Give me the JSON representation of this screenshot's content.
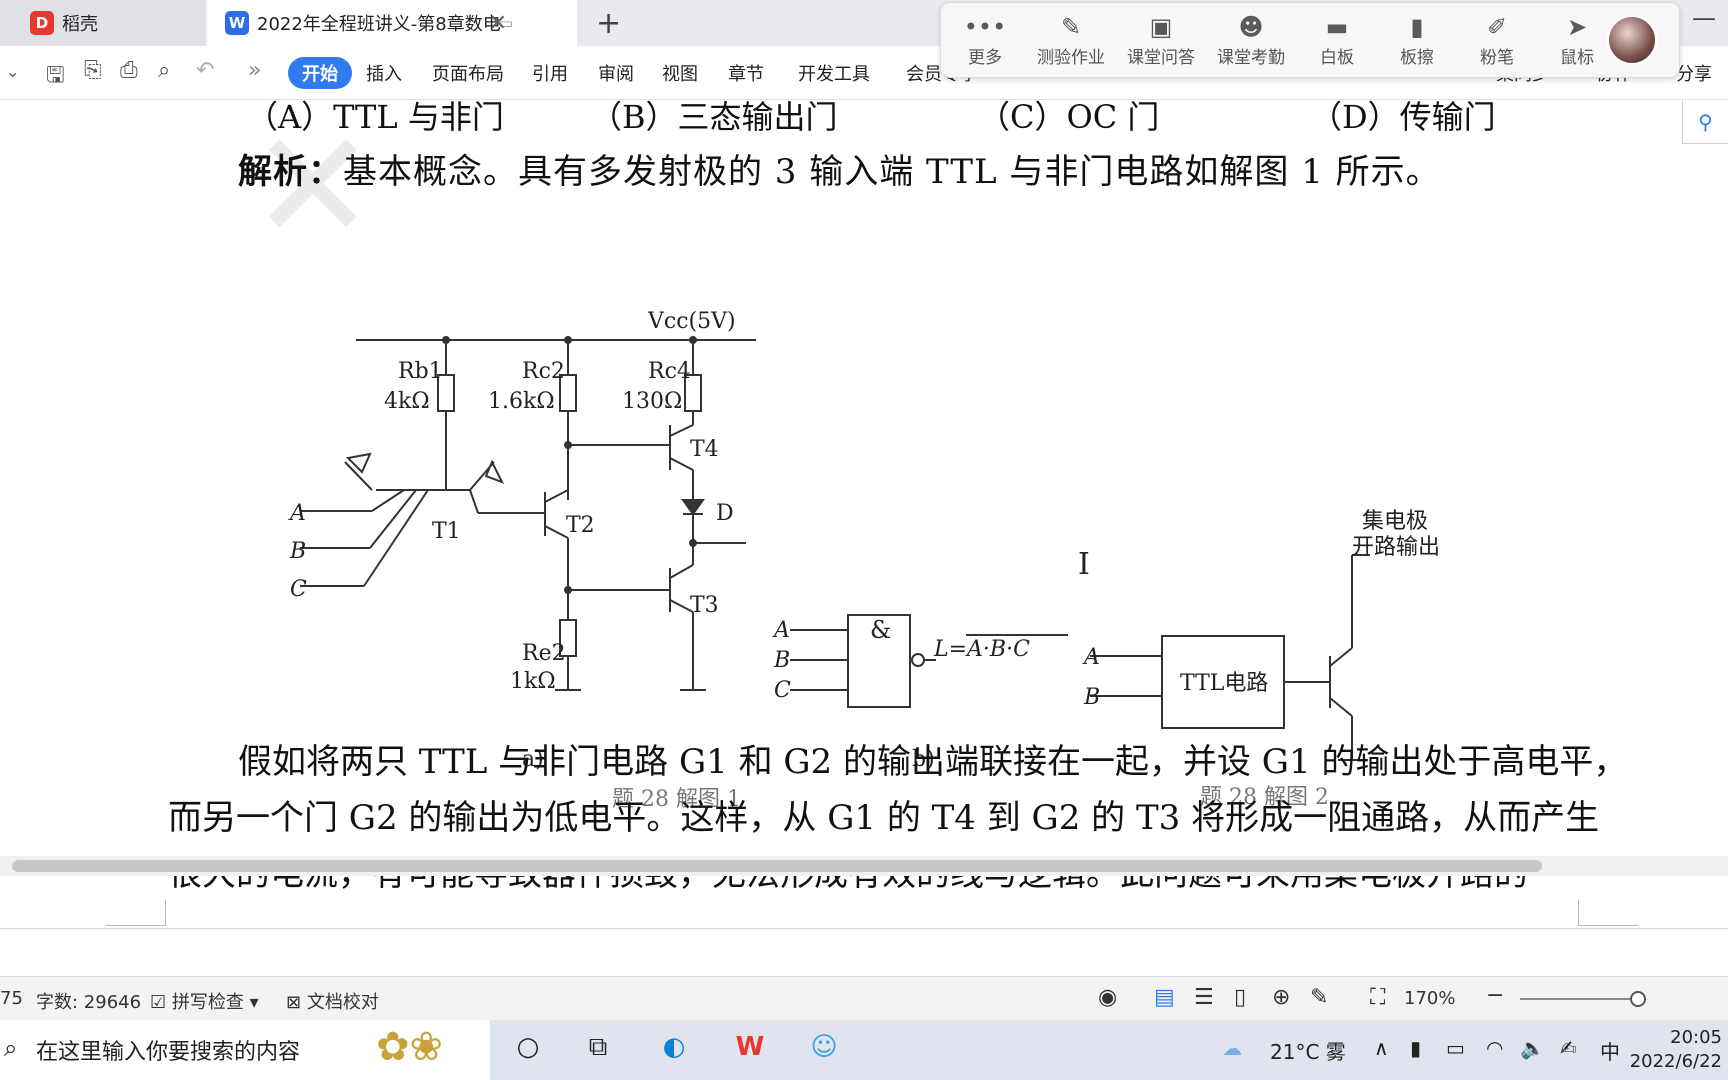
{
  "tabs": [
    {
      "label": "稻壳"
    },
    {
      "label": "2022年全程班讲义-第8章数电"
    }
  ],
  "class_toolbar": [
    {
      "label": "更多"
    },
    {
      "label": "测验作业"
    },
    {
      "label": "课堂问答"
    },
    {
      "label": "课堂考勤"
    },
    {
      "label": "白板"
    },
    {
      "label": "板擦"
    },
    {
      "label": "粉笔"
    },
    {
      "label": "鼠标"
    }
  ],
  "ribbon": {
    "start": "开始",
    "menus": [
      "插入",
      "页面布局",
      "引用",
      "审阅",
      "视图",
      "章节",
      "开发工具",
      "会员专享"
    ],
    "partial_right": [
      "集同步",
      "协作",
      "分享"
    ]
  },
  "document": {
    "options": [
      "（A）TTL 与非门",
      "（B）三态输出门",
      "（C）OC 门",
      "（D）传输门"
    ],
    "analysis_label": "解析：",
    "analysis_text": "基本概念。具有多发射极的 3 输入端 TTL 与非门电路如解图 1 所示。",
    "figure1": {
      "vcc": "Vcc(5V)",
      "rb1": "Rb1",
      "rb1_val": "4kΩ",
      "rc2": "Rc2",
      "rc2_val": "1.6kΩ",
      "rc4": "Rc4",
      "rc4_val": "130Ω",
      "re2": "Re2",
      "re2_val": "1kΩ",
      "t1": "T1",
      "t2": "T2",
      "t3": "T3",
      "t4": "T4",
      "d": "D",
      "inputs": [
        "A",
        "B",
        "C"
      ],
      "sub_a": "a)",
      "gate_symbol": "&",
      "gate_output": "L=A·B·C",
      "sub_b": "b)",
      "caption": "题 28 解图 1"
    },
    "figure2": {
      "label": "集电极开路输出",
      "label_line1": "集电极",
      "label_line2": "开路输出",
      "box": "TTL电路",
      "inputs": [
        "A",
        "B"
      ],
      "caption": "题 28 解图 2"
    },
    "paragraph": [
      "假如将两只 TTL 与非门电路 G1 和 G2 的输出端联接在一起，并设 G1 的输出处于高电平，",
      "而另一个门 G2 的输出为低电平。这样，从 G1 的 T4 到 G2 的 T3 将形成一阻通路，从而产生",
      "很大的电流，有可能导致器件损毁，无法形成有效的线与逻辑。此问题可采用集电极开路的"
    ]
  },
  "statusbar": {
    "page_fragment": "75",
    "word_count": "字数: 29646",
    "spell_check": "拼写检查",
    "doc_proof": "文档校对",
    "zoom": "170%"
  },
  "taskbar": {
    "search_placeholder": "在这里输入你要搜索的内容",
    "weather": "21°C 雾",
    "ime": "中",
    "time": "20:05",
    "date": "2022/6/22"
  }
}
